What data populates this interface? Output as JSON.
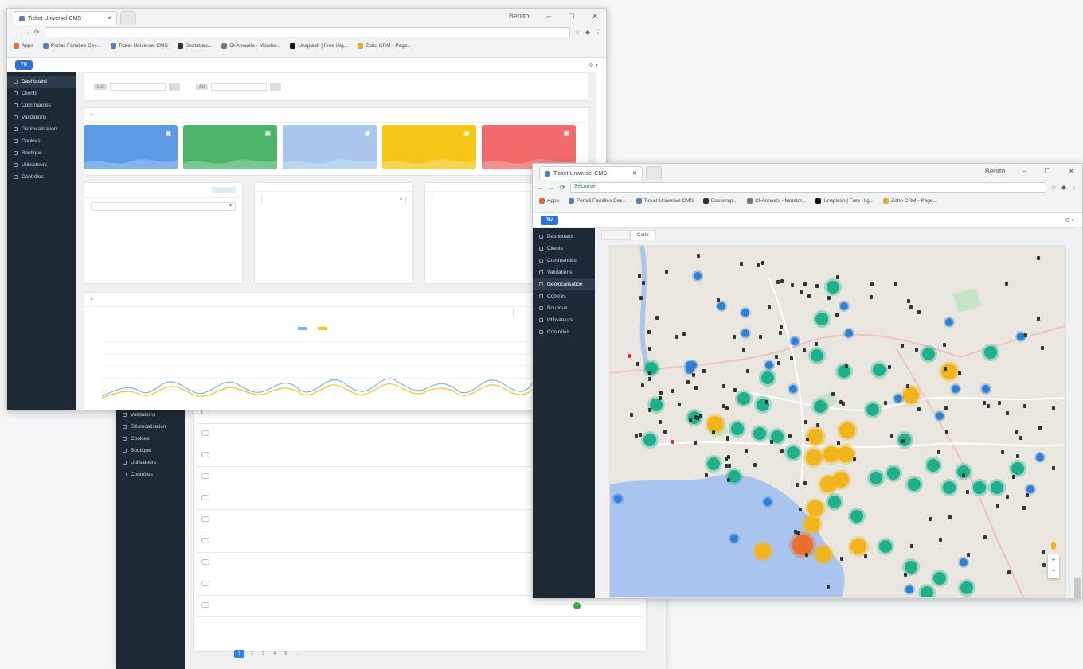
{
  "back_window": {
    "sidebar": {
      "items": [
        {
          "label": ""
        },
        {
          "label": ""
        },
        {
          "label": ""
        },
        {
          "label": ""
        },
        {
          "label": ""
        },
        {
          "label": ""
        }
      ]
    }
  },
  "window1": {
    "tab": {
      "title": "Ticket Universel CMS"
    },
    "winctl": {
      "user": "Benito",
      "minimize": "–",
      "maximize": "☐",
      "close": "✕"
    },
    "url": "",
    "bookmarks": [
      {
        "label": "Apps"
      },
      {
        "label": "Portail Familles Cev..."
      },
      {
        "label": "Ticket Universel CMS"
      },
      {
        "label": "Bootstrap..."
      },
      {
        "label": "Cl-Annuels - Monitor..."
      },
      {
        "label": "Unsplash | Free Hig..."
      },
      {
        "label": "Zoho CRM - Page..."
      }
    ],
    "sidebar": {
      "items": [
        {
          "label": "Dashboard"
        },
        {
          "label": "Clients"
        },
        {
          "label": "Commandes"
        },
        {
          "label": "Validations"
        },
        {
          "label": "Géolocalisation"
        },
        {
          "label": "Cookies"
        },
        {
          "label": "Boutique"
        },
        {
          "label": "Utilisateurs"
        },
        {
          "label": "Contrôles"
        }
      ]
    },
    "filters": {
      "from_label": "Du",
      "to_label": "Au"
    },
    "stats_title": "",
    "cards": [
      {
        "big": "",
        "sub": "",
        "color": "#5b9be6"
      },
      {
        "big": "",
        "sub": "",
        "color": "#4cb46a"
      },
      {
        "big": "",
        "sub": "",
        "color": "#a9c7ec"
      },
      {
        "big": "",
        "sub": "",
        "color": "#f5c518"
      },
      {
        "big": "",
        "sub": "",
        "color": "#f26b6b"
      }
    ],
    "panels": [
      {
        "title": "",
        "select": "",
        "lines": []
      },
      {
        "title": "",
        "select": "",
        "lines": []
      },
      {
        "title": "",
        "select": "",
        "lines": []
      }
    ],
    "chart_panel": {
      "title": "",
      "buttons": [
        {
          "label": ""
        },
        {
          "label": ""
        },
        {
          "label": ""
        }
      ],
      "legend": [
        {
          "label": "",
          "color": "#7fb3e8"
        },
        {
          "label": "",
          "color": "#f5c518"
        }
      ]
    }
  },
  "table": {
    "rows": [
      {
        "id": "",
        "date": "",
        "first": "",
        "last": "",
        "email": "",
        "amount": "",
        "qty": ""
      },
      {
        "id": "",
        "date": "",
        "first": "",
        "last": "",
        "email": "",
        "amount": "",
        "qty": ""
      },
      {
        "id": "",
        "date": "",
        "first": "",
        "last": "",
        "email": "",
        "amount": "",
        "qty": ""
      },
      {
        "id": "",
        "date": "",
        "first": "",
        "last": "",
        "email": "",
        "amount": "",
        "qty": ""
      },
      {
        "id": "",
        "date": "",
        "first": "",
        "last": "",
        "email": "",
        "amount": "",
        "qty": ""
      },
      {
        "id": "",
        "date": "",
        "first": "",
        "last": "",
        "email": "",
        "amount": "",
        "qty": ""
      },
      {
        "id": "",
        "date": "",
        "first": "",
        "last": "",
        "email": "",
        "amount": "",
        "qty": ""
      },
      {
        "id": "",
        "date": "",
        "first": "",
        "last": "",
        "email": "",
        "amount": "",
        "qty": ""
      },
      {
        "id": "",
        "date": "",
        "first": "",
        "last": "",
        "email": "",
        "amount": "",
        "qty": ""
      },
      {
        "id": "",
        "date": "",
        "first": "",
        "last": "",
        "email": "",
        "amount": "",
        "qty": ""
      }
    ],
    "pager": {
      "prev": "",
      "pages": [
        "1",
        "2",
        "3",
        "4",
        "5",
        "...",
        ""
      ],
      "next": ""
    },
    "footer": ""
  },
  "window2": {
    "tab": {
      "title": "Ticket Universel CMS"
    },
    "winctl": {
      "user": "Benito",
      "minimize": "–",
      "maximize": "☐",
      "close": "✕"
    },
    "url": "Sécurisé",
    "bookmarks": [
      {
        "label": "Apps"
      },
      {
        "label": "Portail Familles Cev..."
      },
      {
        "label": "Ticket Universel CMS"
      },
      {
        "label": "Bootstrap..."
      },
      {
        "label": "Cl-Annuels - Monitor..."
      },
      {
        "label": "Unsplash | Free Hig..."
      },
      {
        "label": "Zoho CRM - Page..."
      }
    ],
    "sidebar": {
      "items": [
        {
          "label": "Dashboard"
        },
        {
          "label": "Clients"
        },
        {
          "label": "Commandes"
        },
        {
          "label": "Validations"
        },
        {
          "label": "Géolocalisation"
        },
        {
          "label": "Cookies"
        },
        {
          "label": "Boutique"
        },
        {
          "label": "Utilisateurs"
        },
        {
          "label": "Contrôles"
        }
      ]
    },
    "map_tabs": [
      {
        "label": ""
      },
      {
        "label": "Carte"
      }
    ],
    "colors": {
      "green": "#1eb08a",
      "blue": "#2f7fd3",
      "yellow": "#f2b41c",
      "orange": "#e8702a",
      "sea": "#a9c4ef"
    }
  }
}
